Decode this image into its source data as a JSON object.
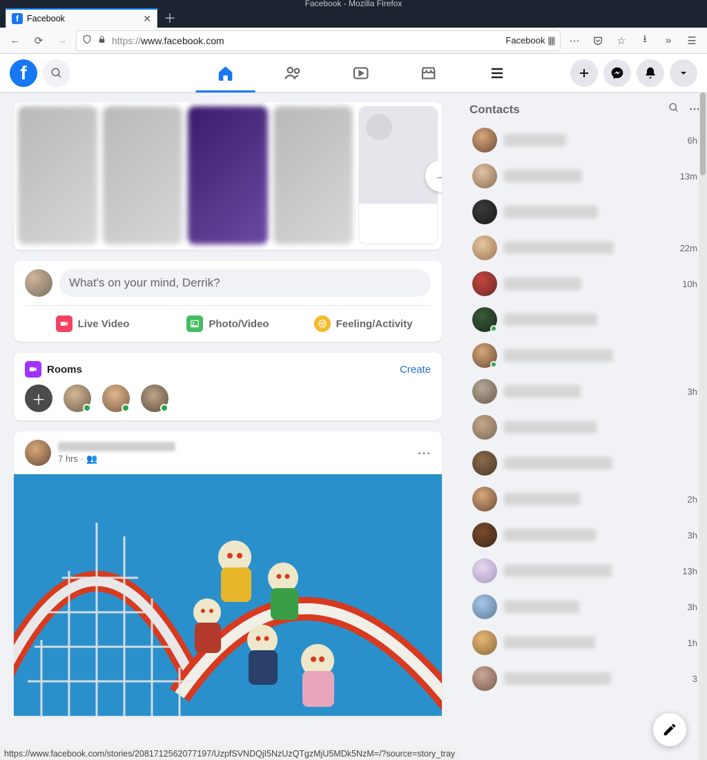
{
  "window": {
    "title": "Facebook - Mozilla Firefox"
  },
  "browser": {
    "tab_label": "Facebook",
    "url_display_proto": "https://",
    "url_display_host": "www.facebook.com",
    "reader_label": "Facebook",
    "status_bar": "https://www.facebook.com/stories/2081712562077197/UzpfSVNDQjI5NzUzQTgzMjU5MDk5NzM=/?source=story_tray"
  },
  "composer": {
    "placeholder": "What's on your mind, Derrik?",
    "live": "Live Video",
    "photo": "Photo/Video",
    "feeling": "Feeling/Activity"
  },
  "rooms": {
    "title": "Rooms",
    "create": "Create"
  },
  "post": {
    "time": "7 hrs",
    "audience_glyph": "👥"
  },
  "contacts": {
    "title": "Contacts",
    "items": [
      {
        "time": "6h",
        "online": false
      },
      {
        "time": "13m",
        "online": false
      },
      {
        "time": "",
        "online": false
      },
      {
        "time": "22m",
        "online": false
      },
      {
        "time": "10h",
        "online": false
      },
      {
        "time": "",
        "online": true
      },
      {
        "time": "",
        "online": true
      },
      {
        "time": "3h",
        "online": false
      },
      {
        "time": "",
        "online": false
      },
      {
        "time": "",
        "online": false
      },
      {
        "time": "2h",
        "online": false
      },
      {
        "time": "3h",
        "online": false
      },
      {
        "time": "13h",
        "online": false
      },
      {
        "time": "3h",
        "online": false
      },
      {
        "time": "1h",
        "online": false
      },
      {
        "time": "3",
        "online": false
      }
    ]
  }
}
